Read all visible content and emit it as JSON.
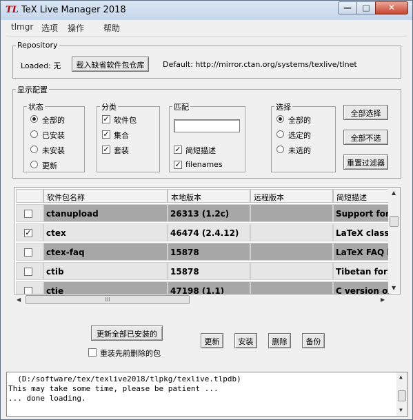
{
  "window": {
    "title": "TeX Live Manager 2018",
    "icon": "TL",
    "controls": {
      "minimize": "—",
      "maximize": "□",
      "close": "✕"
    }
  },
  "menu": [
    "tlmgr",
    "选项",
    "操作",
    "帮助"
  ],
  "repository": {
    "group_title": "Repository",
    "loaded_label": "Loaded: 无",
    "load_button": "载入缺省软件包仓库",
    "default_text": "Default: http://mirror.ctan.org/systems/texlive/tlnet"
  },
  "display_config": {
    "group_title": "显示配置",
    "status": {
      "title": "状态",
      "options": [
        "全部的",
        "已安装",
        "未安装",
        "更新"
      ],
      "selected": 0
    },
    "category": {
      "title": "分类",
      "options": [
        "软件包",
        "集合",
        "套装"
      ],
      "checked": [
        true,
        true,
        true
      ]
    },
    "match": {
      "title": "匹配",
      "input_value": "",
      "options": [
        "简短描述",
        "filenames"
      ],
      "checked": [
        true,
        true
      ]
    },
    "select": {
      "title": "选择",
      "options": [
        "全部的",
        "选定的",
        "未选的"
      ],
      "selected": 0
    },
    "buttons": [
      "全部选择",
      "全部不选",
      "重置过滤器"
    ]
  },
  "table": {
    "headers": [
      "",
      "软件包名称",
      "本地版本",
      "远程版本",
      "简短描述"
    ],
    "rows": [
      {
        "checked": false,
        "name": "ctanupload",
        "local": "26313 (1.2c)",
        "remote": "",
        "desc": "Support for us"
      },
      {
        "checked": true,
        "name": "ctex",
        "local": "46474 (2.4.12)",
        "remote": "",
        "desc": "LaTeX classe"
      },
      {
        "checked": false,
        "name": "ctex-faq",
        "local": "15878",
        "remote": "",
        "desc": "LaTeX FAQ by"
      },
      {
        "checked": false,
        "name": "ctib",
        "local": "15878",
        "remote": "",
        "desc": "Tibetan for Te"
      },
      {
        "checked": false,
        "name": "ctie",
        "local": "47198 (1.1)",
        "remote": "",
        "desc": "C version of ti"
      }
    ],
    "hscroll_grip": "III"
  },
  "actions": {
    "update_all": "更新全部已安装的",
    "reinstall_removed": "重装先前删除的包",
    "reinstall_checked": false,
    "update": "更新",
    "install": "安装",
    "remove": "删除",
    "backup": "备份"
  },
  "log": [
    "  (D:/software/tex/texlive2018/tlpkg/texlive.tlpdb)",
    "This may take some time, please be patient ...",
    "... done loading."
  ]
}
